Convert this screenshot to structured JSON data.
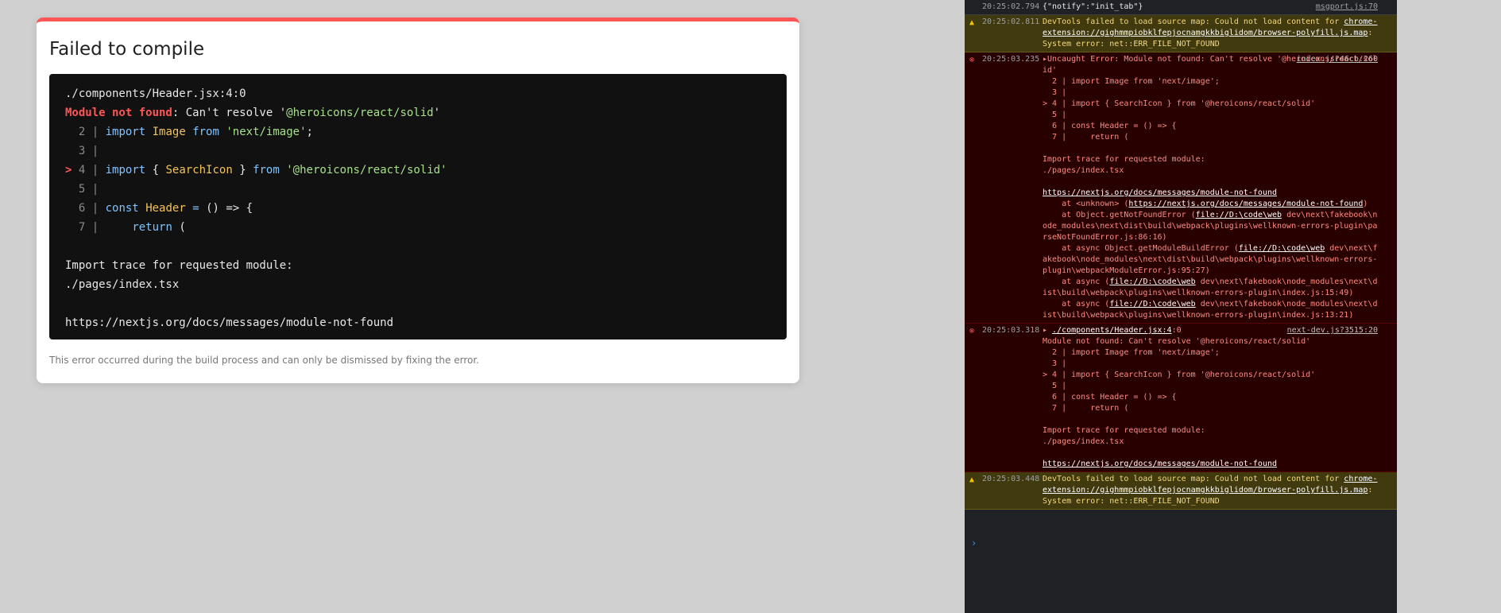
{
  "dialog": {
    "title": "Failed to compile",
    "file": "./components/Header.jsx:4:0",
    "error_kind": "Module not found",
    "error_rest_pre": ": Can't resolve '",
    "error_module": "@heroicons/react/solid",
    "error_rest_post": "'",
    "code": {
      "l2_num": "2",
      "l2_a": "import",
      "l2_b": "Image",
      "l2_c": "from",
      "l2_d": "'next/image'",
      "l2_e": ";",
      "l3_num": "3",
      "l4_marker": ">",
      "l4_num": "4",
      "l4_a": "import",
      "l4_b": "{ ",
      "l4_c": "SearchIcon",
      "l4_d": " }",
      "l4_e": "from",
      "l4_f": "'@heroicons/react/solid'",
      "l5_num": "5",
      "l6_num": "6",
      "l6_a": "const",
      "l6_b": "Header",
      "l6_c": "=",
      "l6_d": "() =>",
      "l6_e": "{",
      "l7_num": "7",
      "l7_a": "return",
      "l7_b": "("
    },
    "trace_heading": "Import trace for requested module:",
    "trace_path": "./pages/index.tsx",
    "docs_link": "https://nextjs.org/docs/messages/module-not-found",
    "footer": "This error occurred during the build process and can only be dismissed by fixing the error."
  },
  "console": {
    "entries": [
      {
        "level": "info",
        "time": "20:25:02.794",
        "message": "{\"notify\":\"init_tab\"}",
        "source": "msgport.js:70"
      },
      {
        "level": "warning",
        "time": "20:25:02.811",
        "message_pre": "DevTools failed to load source map: Could not load content for ",
        "link": "chrome-extension://gighmmpiobklfepjocnamgkkbiglidom/browser-polyfill.js.map",
        "message_post": ": System error: net::ERR_FILE_NOT_FOUND"
      },
      {
        "level": "error",
        "time": "20:25:03.235",
        "source": "index.js?46cb:260",
        "head": "▸Uncaught Error: Module not found: Can't resolve '@heroicons/react/solid'",
        "code": "  2 | import Image from 'next/image';\n  3 |\n> 4 | import { SearchIcon } from '@heroicons/react/solid'\n  5 |\n  6 | const Header = () => {\n  7 |     return (\n\nImport trace for requested module:\n./pages/index.tsx\n\n",
        "docs_link": "https://nextjs.org/docs/messages/module-not-found",
        "stack1_pre": "    at <unknown> (",
        "stack1_link": "https://nextjs.org/docs/messages/module-not-found",
        "stack1_post": ")",
        "stack2_pre": "    at Object.getNotFoundError (",
        "stack2_link": "file://D:\\code\\web",
        "stack2_post": " dev\\next\\fakebook\\node_modules\\next\\dist\\build\\webpack\\plugins\\wellknown-errors-plugin\\parseNotFoundError.js:86:16)",
        "stack3_pre": "    at async Object.getModuleBuildError (",
        "stack3_link": "file://D:\\code\\web",
        "stack3_post": " dev\\next\\fakebook\\node_modules\\next\\dist\\build\\webpack\\plugins\\wellknown-errors-plugin\\webpackModuleError.js:95:27)",
        "stack4_pre": "    at async (",
        "stack4_link": "file://D:\\code\\web",
        "stack4_post": " dev\\next\\fakebook\\node_modules\\next\\dist\\build\\webpack\\plugins\\wellknown-errors-plugin\\index.js:15:49)",
        "stack5_pre": "    at async (",
        "stack5_link": "file://D:\\code\\web",
        "stack5_post": " dev\\next\\fakebook\\node_modules\\next\\dist\\build\\webpack\\plugins\\wellknown-errors-plugin\\index.js:13:21)"
      },
      {
        "level": "error",
        "time": "20:25:03.318",
        "source": "next-dev.js?3515:20",
        "head_arrow": "▸ ",
        "head_link": "./components/Header.jsx:4",
        "head_post": ":0",
        "code": "Module not found: Can't resolve '@heroicons/react/solid'\n  2 | import Image from 'next/image';\n  3 |\n> 4 | import { SearchIcon } from '@heroicons/react/solid'\n  5 |\n  6 | const Header = () => {\n  7 |     return (\n\nImport trace for requested module:\n./pages/index.tsx\n\n",
        "docs_link": "https://nextjs.org/docs/messages/module-not-found"
      },
      {
        "level": "warning",
        "time": "20:25:03.448",
        "message_pre": "DevTools failed to load source map: Could not load content for ",
        "link": "chrome-extension://gighmmpiobklfepjocnamgkkbiglidom/browser-polyfill.js.map",
        "message_post": ": System error: net::ERR_FILE_NOT_FOUND"
      }
    ],
    "prompt": "›"
  },
  "icons": {
    "warning": "warning-icon",
    "error": "error-icon"
  },
  "colors": {
    "accent_error": "#ff5555",
    "console_bg": "#202124",
    "error_bg": "#290000",
    "warning_bg": "#413a0f"
  }
}
